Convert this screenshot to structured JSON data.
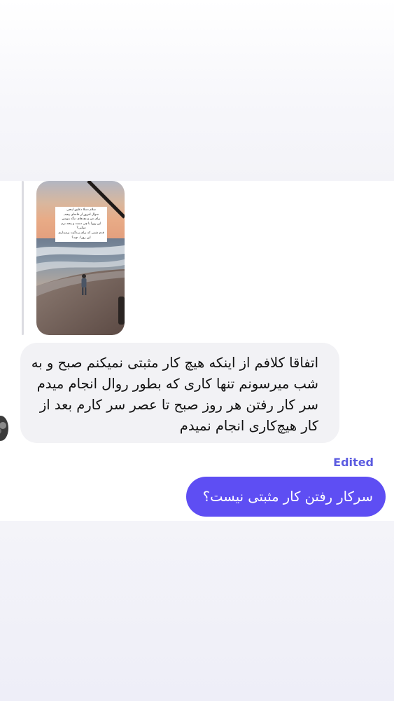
{
  "story": {
    "caption_lines": [
      "سلام دسلا دعلیق اینجی",
      "سوال امروز از خانمای پیجه,",
      "برای من و بچه‌های دیگه بنویس",
      "این روزا با چی دست و پنجه نرم",
      "میکنی?",
      "قدم مثبتی که برای زندگیت برمیداری",
      "این روزا ، چیه؟"
    ]
  },
  "messages": {
    "incoming_text": "اتفاقا کلافم از اینکه هیچ کار مثبتی نمیکنم صبح و به شب میرسونم تنها کاری که بطور روال انجام میدم سر کار رفتن هر روز صبح تا عصر سر کارم بعد از کار هیچ‌کاری انجام نمیدم",
    "edited_label": "Edited",
    "outgoing_text": "سرکار رفتن کار مثبتی نیست؟"
  },
  "colors": {
    "outgoing_bubble": "#5e4ef3",
    "incoming_bubble": "#f2f2f5",
    "edited_label": "#5b5be0"
  }
}
